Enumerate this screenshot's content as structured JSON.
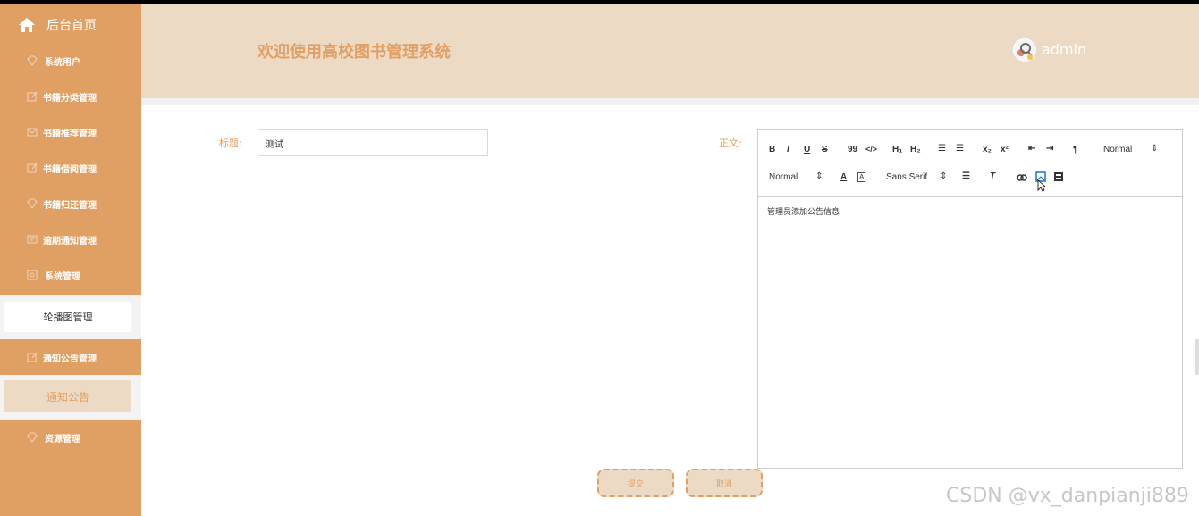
{
  "sidebar": {
    "home_label": "后台首页",
    "items": [
      {
        "label": "系统用户",
        "icon": "diamond-icon"
      },
      {
        "label": "书籍分类管理",
        "icon": "edit-icon"
      },
      {
        "label": "书籍推荐管理",
        "icon": "mail-icon"
      },
      {
        "label": "书籍借阅管理",
        "icon": "edit-icon"
      },
      {
        "label": "书籍归还管理",
        "icon": "diamond-icon"
      },
      {
        "label": "逾期通知管理",
        "icon": "message-icon"
      },
      {
        "label": "系统管理",
        "icon": "settings-box-icon"
      },
      {
        "label": "轮播图管理"
      },
      {
        "label": "通知公告管理",
        "icon": "edit-icon"
      },
      {
        "label": "通知公告"
      },
      {
        "label": "资源管理",
        "icon": "diamond-icon"
      }
    ]
  },
  "header": {
    "title": "欢迎使用高校图书管理系统",
    "username": "admin"
  },
  "form": {
    "title_label": "标题:",
    "title_value": "测试",
    "content_label": "正文:",
    "content_text": "管理员添加公告信息",
    "submit_label": "提交",
    "cancel_label": "取消"
  },
  "toolbar": {
    "bold": "B",
    "italic": "I",
    "underline": "U",
    "strike": "S",
    "quote": "99",
    "code": "</>",
    "h1": "H₁",
    "h2": "H₂",
    "ordered_list": "☰",
    "bullet_list": "☰",
    "subscript": "x₂",
    "superscript": "x²",
    "outdent": "⇤",
    "indent": "⇥",
    "direction": "¶",
    "size_select": "Normal",
    "header_select": "Normal",
    "font_select": "Sans Serif"
  },
  "watermark": "CSDN @vx_danpianji889",
  "colors": {
    "accent": "#e0a064",
    "header_bg": "#ecdac5"
  }
}
